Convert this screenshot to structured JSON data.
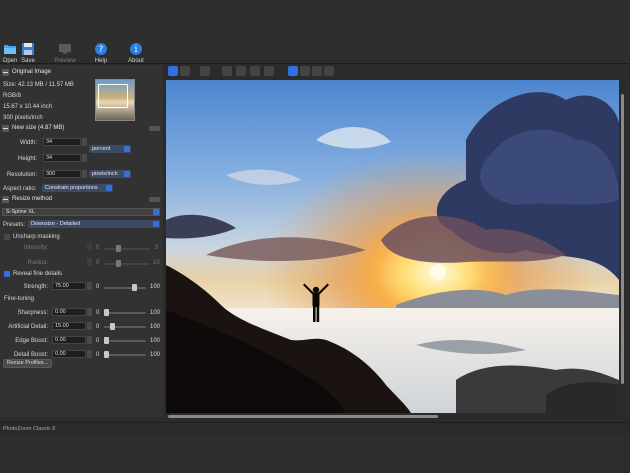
{
  "toolbar": {
    "items": [
      {
        "label": "Open",
        "icon": "folder-icon"
      },
      {
        "label": "Save",
        "icon": "floppy-icon"
      },
      {
        "label": "Preview",
        "icon": "monitor-icon"
      },
      {
        "label": "Help",
        "icon": "help-icon"
      },
      {
        "label": "About",
        "icon": "info-icon"
      }
    ]
  },
  "original": {
    "header": "Original Image",
    "size": "Size: 42.13 MB / 11.57 MB",
    "mode": "RGB/8",
    "dims": "15.67 x 10.44 inch",
    "res": "300 pixels/inch"
  },
  "newsize": {
    "header": "New size (4.87 MB)",
    "width_label": "Width:",
    "width_value": "34",
    "height_label": "Height:",
    "height_value": "34",
    "unit": "percent",
    "res_label": "Resolution:",
    "res_value": "300",
    "res_unit": "pixels/inch",
    "aspect_label": "Aspect ratio:",
    "aspect_value": "Constrain proportions"
  },
  "resize": {
    "header": "Resize method",
    "method": "S-Spline XL",
    "presets_label": "Presets:",
    "presets_value": "Downsize - Detailed"
  },
  "unsharp": {
    "label": "Unsharp masking",
    "intensity_label": "Intensity:",
    "intensity_min": "0",
    "intensity_max": "5",
    "intensity_level": 0.3,
    "radius_label": "Radius:",
    "radius_min": "0",
    "radius_max": "10",
    "radius_level": 0.3
  },
  "reveal": {
    "label": "Reveal fine details",
    "strength_label": "Strength:",
    "strength_value": "75.00",
    "min": "0",
    "max": "100",
    "level": 0.75
  },
  "finetuning": {
    "header": "Fine-tuning",
    "rows": [
      {
        "label": "Sharpness:",
        "value": "0.00",
        "min": "0",
        "max": "100",
        "level": 0.0
      },
      {
        "label": "Artificial Detail:",
        "value": "15.00",
        "min": "0",
        "max": "100",
        "level": 0.15
      },
      {
        "label": "Edge Boost:",
        "value": "0.00",
        "min": "0",
        "max": "100",
        "level": 0.0
      },
      {
        "label": "Detail Boost:",
        "value": "0.00",
        "min": "0",
        "max": "100",
        "level": 0.0
      }
    ]
  },
  "resize_profiles_label": "Resize Profiles...",
  "status": "PhotoZoom Classic 8",
  "colors": {
    "accent": "#3a6fd8",
    "sidebar": "#323232",
    "toolbar": "#2e2e2e"
  }
}
